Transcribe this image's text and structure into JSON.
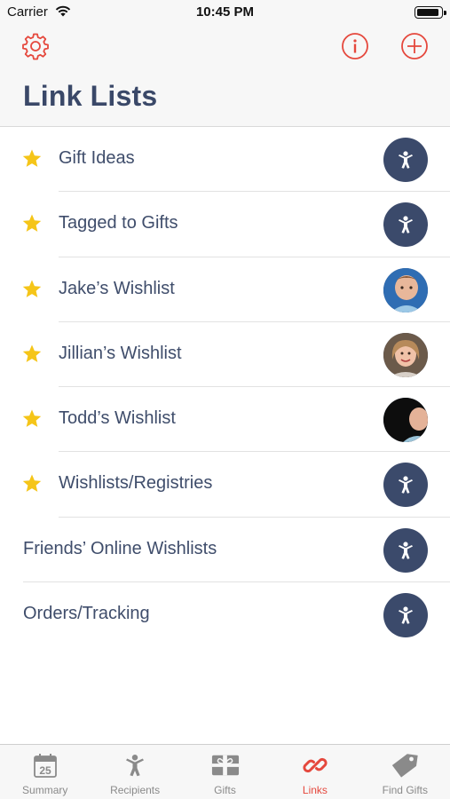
{
  "status_bar": {
    "carrier": "Carrier",
    "time": "10:45 PM"
  },
  "nav": {
    "title": "Link Lists"
  },
  "colors": {
    "accent": "#e5483d",
    "navy": "#3b4a6b",
    "star": "#f5c518"
  },
  "lists": [
    {
      "label": "Gift Ideas",
      "starred": true,
      "avatar": "person-icon"
    },
    {
      "label": "Tagged to Gifts",
      "starred": true,
      "avatar": "person-icon"
    },
    {
      "label": "Jake’s Wishlist",
      "starred": true,
      "avatar": "photo-toddler"
    },
    {
      "label": "Jillian’s Wishlist",
      "starred": true,
      "avatar": "photo-girl"
    },
    {
      "label": "Todd’s Wishlist",
      "starred": true,
      "avatar": "photo-child-dark"
    },
    {
      "label": "Wishlists/Registries",
      "starred": true,
      "avatar": "person-icon"
    },
    {
      "label": "Friends’ Online Wishlists",
      "starred": false,
      "avatar": "person-icon"
    },
    {
      "label": "Orders/Tracking",
      "starred": false,
      "avatar": "person-icon"
    }
  ],
  "tabs": [
    {
      "label": "Summary",
      "icon": "calendar-icon",
      "calendar_day": "25",
      "active": false
    },
    {
      "label": "Recipients",
      "icon": "person-icon",
      "active": false
    },
    {
      "label": "Gifts",
      "icon": "gift-icon",
      "active": false
    },
    {
      "label": "Links",
      "icon": "link-icon",
      "active": true
    },
    {
      "label": "Find Gifts",
      "icon": "tag-icon",
      "active": false
    }
  ]
}
